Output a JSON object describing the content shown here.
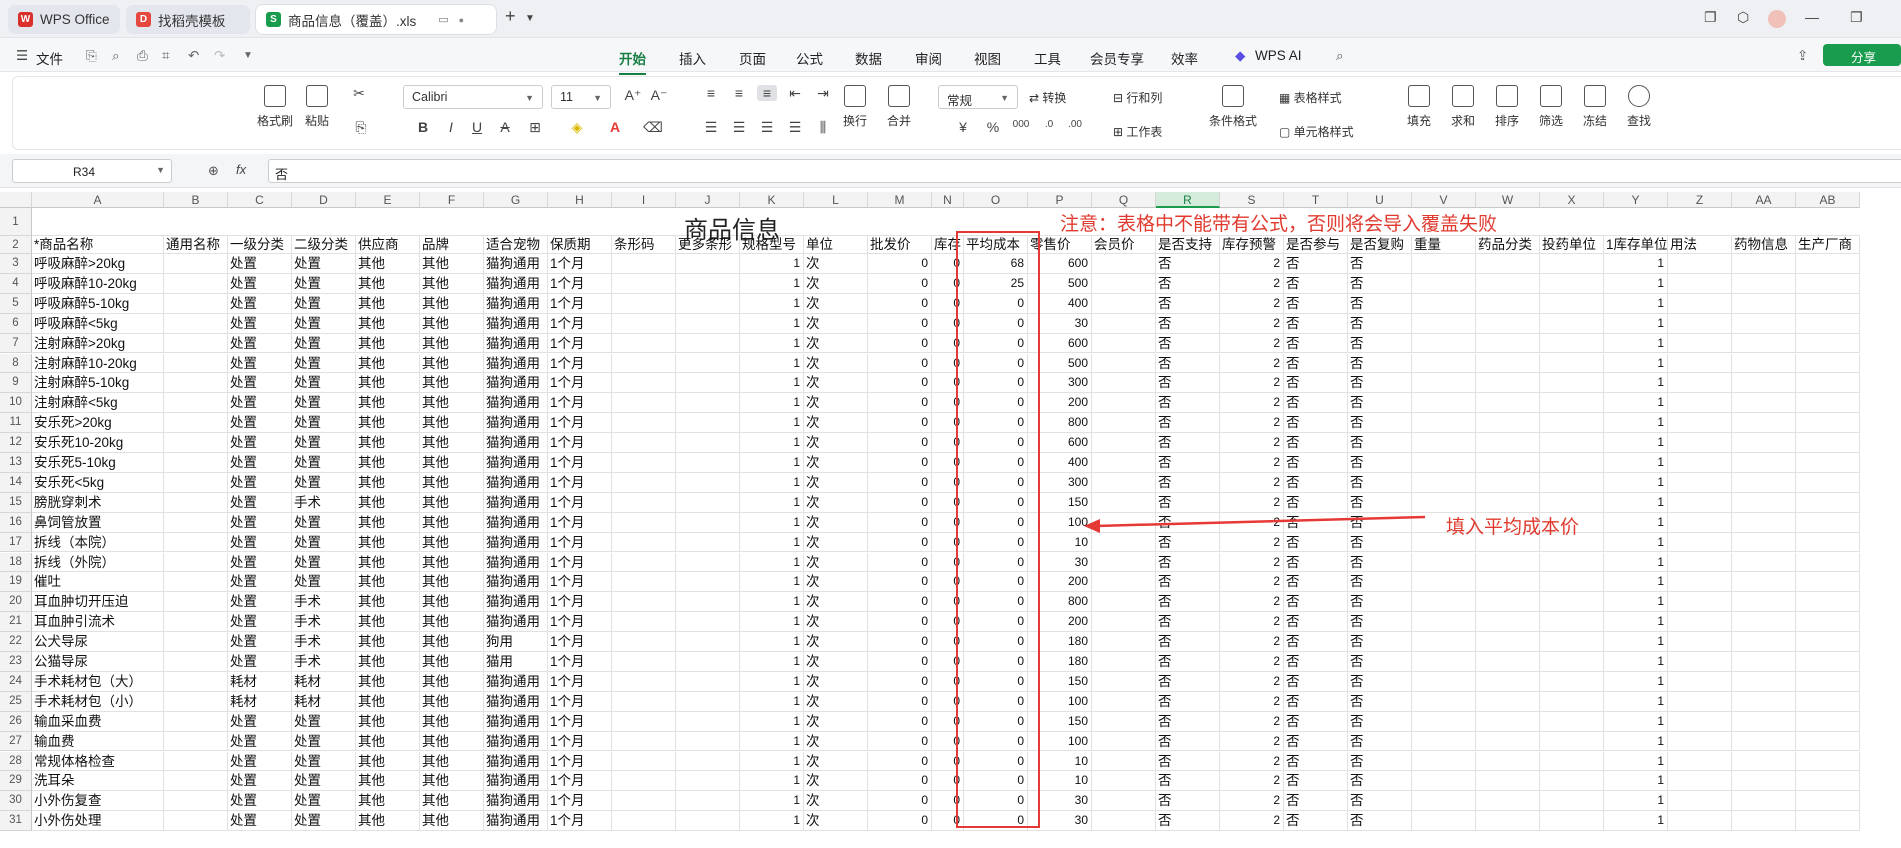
{
  "tabs": {
    "items": [
      {
        "label": "WPS Office",
        "icon": "wps-logo-icon"
      },
      {
        "label": "找稻壳模板",
        "icon": "docer-icon"
      },
      {
        "label": "商品信息（覆盖）.xls",
        "icon": "sheet-icon"
      }
    ],
    "new_tab": "+"
  },
  "menu": {
    "file": "文件",
    "tabs": [
      "开始",
      "插入",
      "页面",
      "公式",
      "数据",
      "审阅",
      "视图",
      "工具",
      "会员专享",
      "效率"
    ],
    "active_tab": "开始",
    "ai": "WPS AI",
    "share": "分享"
  },
  "ribbon": {
    "format_painter": "格式刷",
    "paste": "粘贴",
    "font_name": "Calibri",
    "font_size": "11",
    "wrap": "换行",
    "merge": "合并",
    "number_format": "常规",
    "convert": "转换",
    "row_col": "行和列",
    "worksheet": "工作表",
    "cond_format": "条件格式",
    "table_style": "表格样式",
    "cell_style": "单元格样式",
    "fill": "填充",
    "sum": "求和",
    "sort": "排序",
    "filter": "筛选",
    "freeze": "冻结",
    "find": "查找",
    "currency": "¥",
    "percent": "%"
  },
  "formula_bar": {
    "name_box": "R34",
    "fx": "fx",
    "content": "否"
  },
  "sheet": {
    "columns": [
      "A",
      "B",
      "C",
      "D",
      "E",
      "F",
      "G",
      "H",
      "I",
      "J",
      "K",
      "L",
      "M",
      "N",
      "O",
      "P",
      "Q",
      "R",
      "S",
      "T",
      "U",
      "V",
      "W",
      "X",
      "Y",
      "Z",
      "AA",
      "AB"
    ],
    "selected_column": "R",
    "title": "商品信息",
    "headers": [
      "*商品名称",
      "通用名称",
      "一级分类",
      "二级分类",
      "供应商",
      "品牌",
      "适合宠物",
      "保质期",
      "条形码",
      "更多条形",
      "规格型号",
      "单位",
      "批发价",
      "库存",
      "平均成本",
      "零售价",
      "会员价",
      "是否支持",
      "库存预警",
      "是否参与",
      "是否复购",
      "重量",
      "药品分类",
      "投药单位",
      "1库存单位",
      "用法",
      "药物信息",
      "生产厂商"
    ],
    "rows": [
      {
        "n": "3",
        "a": "呼吸麻醉>20kg",
        "c": "处置",
        "d": "处置",
        "e": "其他",
        "f": "其他",
        "g": "猫狗通用",
        "h": "1个月",
        "k": "1",
        "l": "次",
        "m": "0",
        "n2": "0",
        "o": "68",
        "p": "600",
        "r": "否",
        "s": "2",
        "t": "否",
        "u": "否",
        "y": "1"
      },
      {
        "n": "4",
        "a": "呼吸麻醉10-20kg",
        "c": "处置",
        "d": "处置",
        "e": "其他",
        "f": "其他",
        "g": "猫狗通用",
        "h": "1个月",
        "k": "1",
        "l": "次",
        "m": "0",
        "n2": "0",
        "o": "25",
        "p": "500",
        "r": "否",
        "s": "2",
        "t": "否",
        "u": "否",
        "y": "1"
      },
      {
        "n": "5",
        "a": "呼吸麻醉5-10kg",
        "c": "处置",
        "d": "处置",
        "e": "其他",
        "f": "其他",
        "g": "猫狗通用",
        "h": "1个月",
        "k": "1",
        "l": "次",
        "m": "0",
        "n2": "0",
        "o": "0",
        "p": "400",
        "r": "否",
        "s": "2",
        "t": "否",
        "u": "否",
        "y": "1"
      },
      {
        "n": "6",
        "a": "呼吸麻醉<5kg",
        "c": "处置",
        "d": "处置",
        "e": "其他",
        "f": "其他",
        "g": "猫狗通用",
        "h": "1个月",
        "k": "1",
        "l": "次",
        "m": "0",
        "n2": "0",
        "o": "0",
        "p": "30",
        "r": "否",
        "s": "2",
        "t": "否",
        "u": "否",
        "y": "1"
      },
      {
        "n": "7",
        "a": "注射麻醉>20kg",
        "c": "处置",
        "d": "处置",
        "e": "其他",
        "f": "其他",
        "g": "猫狗通用",
        "h": "1个月",
        "k": "1",
        "l": "次",
        "m": "0",
        "n2": "0",
        "o": "0",
        "p": "600",
        "r": "否",
        "s": "2",
        "t": "否",
        "u": "否",
        "y": "1"
      },
      {
        "n": "8",
        "a": "注射麻醉10-20kg",
        "c": "处置",
        "d": "处置",
        "e": "其他",
        "f": "其他",
        "g": "猫狗通用",
        "h": "1个月",
        "k": "1",
        "l": "次",
        "m": "0",
        "n2": "0",
        "o": "0",
        "p": "500",
        "r": "否",
        "s": "2",
        "t": "否",
        "u": "否",
        "y": "1"
      },
      {
        "n": "9",
        "a": "注射麻醉5-10kg",
        "c": "处置",
        "d": "处置",
        "e": "其他",
        "f": "其他",
        "g": "猫狗通用",
        "h": "1个月",
        "k": "1",
        "l": "次",
        "m": "0",
        "n2": "0",
        "o": "0",
        "p": "300",
        "r": "否",
        "s": "2",
        "t": "否",
        "u": "否",
        "y": "1"
      },
      {
        "n": "10",
        "a": "注射麻醉<5kg",
        "c": "处置",
        "d": "处置",
        "e": "其他",
        "f": "其他",
        "g": "猫狗通用",
        "h": "1个月",
        "k": "1",
        "l": "次",
        "m": "0",
        "n2": "0",
        "o": "0",
        "p": "200",
        "r": "否",
        "s": "2",
        "t": "否",
        "u": "否",
        "y": "1"
      },
      {
        "n": "11",
        "a": "安乐死>20kg",
        "c": "处置",
        "d": "处置",
        "e": "其他",
        "f": "其他",
        "g": "猫狗通用",
        "h": "1个月",
        "k": "1",
        "l": "次",
        "m": "0",
        "n2": "0",
        "o": "0",
        "p": "800",
        "r": "否",
        "s": "2",
        "t": "否",
        "u": "否",
        "y": "1"
      },
      {
        "n": "12",
        "a": "安乐死10-20kg",
        "c": "处置",
        "d": "处置",
        "e": "其他",
        "f": "其他",
        "g": "猫狗通用",
        "h": "1个月",
        "k": "1",
        "l": "次",
        "m": "0",
        "n2": "0",
        "o": "0",
        "p": "600",
        "r": "否",
        "s": "2",
        "t": "否",
        "u": "否",
        "y": "1"
      },
      {
        "n": "13",
        "a": "安乐死5-10kg",
        "c": "处置",
        "d": "处置",
        "e": "其他",
        "f": "其他",
        "g": "猫狗通用",
        "h": "1个月",
        "k": "1",
        "l": "次",
        "m": "0",
        "n2": "0",
        "o": "0",
        "p": "400",
        "r": "否",
        "s": "2",
        "t": "否",
        "u": "否",
        "y": "1"
      },
      {
        "n": "14",
        "a": "安乐死<5kg",
        "c": "处置",
        "d": "处置",
        "e": "其他",
        "f": "其他",
        "g": "猫狗通用",
        "h": "1个月",
        "k": "1",
        "l": "次",
        "m": "0",
        "n2": "0",
        "o": "0",
        "p": "300",
        "r": "否",
        "s": "2",
        "t": "否",
        "u": "否",
        "y": "1"
      },
      {
        "n": "15",
        "a": "膀胱穿刺术",
        "c": "处置",
        "d": "手术",
        "e": "其他",
        "f": "其他",
        "g": "猫狗通用",
        "h": "1个月",
        "k": "1",
        "l": "次",
        "m": "0",
        "n2": "0",
        "o": "0",
        "p": "150",
        "r": "否",
        "s": "2",
        "t": "否",
        "u": "否",
        "y": "1"
      },
      {
        "n": "16",
        "a": "鼻饲管放置",
        "c": "处置",
        "d": "处置",
        "e": "其他",
        "f": "其他",
        "g": "猫狗通用",
        "h": "1个月",
        "k": "1",
        "l": "次",
        "m": "0",
        "n2": "0",
        "o": "0",
        "p": "100",
        "r": "否",
        "s": "2",
        "t": "否",
        "u": "否",
        "y": "1"
      },
      {
        "n": "17",
        "a": "拆线（本院）",
        "c": "处置",
        "d": "处置",
        "e": "其他",
        "f": "其他",
        "g": "猫狗通用",
        "h": "1个月",
        "k": "1",
        "l": "次",
        "m": "0",
        "n2": "0",
        "o": "0",
        "p": "10",
        "r": "否",
        "s": "2",
        "t": "否",
        "u": "否",
        "y": "1"
      },
      {
        "n": "18",
        "a": "拆线（外院）",
        "c": "处置",
        "d": "处置",
        "e": "其他",
        "f": "其他",
        "g": "猫狗通用",
        "h": "1个月",
        "k": "1",
        "l": "次",
        "m": "0",
        "n2": "0",
        "o": "0",
        "p": "30",
        "r": "否",
        "s": "2",
        "t": "否",
        "u": "否",
        "y": "1"
      },
      {
        "n": "19",
        "a": "催吐",
        "c": "处置",
        "d": "处置",
        "e": "其他",
        "f": "其他",
        "g": "猫狗通用",
        "h": "1个月",
        "k": "1",
        "l": "次",
        "m": "0",
        "n2": "0",
        "o": "0",
        "p": "200",
        "r": "否",
        "s": "2",
        "t": "否",
        "u": "否",
        "y": "1"
      },
      {
        "n": "20",
        "a": "耳血肿切开压迫",
        "c": "处置",
        "d": "手术",
        "e": "其他",
        "f": "其他",
        "g": "猫狗通用",
        "h": "1个月",
        "k": "1",
        "l": "次",
        "m": "0",
        "n2": "0",
        "o": "0",
        "p": "800",
        "r": "否",
        "s": "2",
        "t": "否",
        "u": "否",
        "y": "1"
      },
      {
        "n": "21",
        "a": "耳血肿引流术",
        "c": "处置",
        "d": "手术",
        "e": "其他",
        "f": "其他",
        "g": "猫狗通用",
        "h": "1个月",
        "k": "1",
        "l": "次",
        "m": "0",
        "n2": "0",
        "o": "0",
        "p": "200",
        "r": "否",
        "s": "2",
        "t": "否",
        "u": "否",
        "y": "1"
      },
      {
        "n": "22",
        "a": "公犬导尿",
        "c": "处置",
        "d": "手术",
        "e": "其他",
        "f": "其他",
        "g": "狗用",
        "h": "1个月",
        "k": "1",
        "l": "次",
        "m": "0",
        "n2": "0",
        "o": "0",
        "p": "180",
        "r": "否",
        "s": "2",
        "t": "否",
        "u": "否",
        "y": "1"
      },
      {
        "n": "23",
        "a": "公猫导尿",
        "c": "处置",
        "d": "手术",
        "e": "其他",
        "f": "其他",
        "g": "猫用",
        "h": "1个月",
        "k": "1",
        "l": "次",
        "m": "0",
        "n2": "0",
        "o": "0",
        "p": "180",
        "r": "否",
        "s": "2",
        "t": "否",
        "u": "否",
        "y": "1"
      },
      {
        "n": "24",
        "a": "手术耗材包（大）",
        "c": "耗材",
        "d": "耗材",
        "e": "其他",
        "f": "其他",
        "g": "猫狗通用",
        "h": "1个月",
        "k": "1",
        "l": "次",
        "m": "0",
        "n2": "0",
        "o": "0",
        "p": "150",
        "r": "否",
        "s": "2",
        "t": "否",
        "u": "否",
        "y": "1"
      },
      {
        "n": "25",
        "a": "手术耗材包（小）",
        "c": "耗材",
        "d": "耗材",
        "e": "其他",
        "f": "其他",
        "g": "猫狗通用",
        "h": "1个月",
        "k": "1",
        "l": "次",
        "m": "0",
        "n2": "0",
        "o": "0",
        "p": "100",
        "r": "否",
        "s": "2",
        "t": "否",
        "u": "否",
        "y": "1"
      },
      {
        "n": "26",
        "a": "输血采血费",
        "c": "处置",
        "d": "处置",
        "e": "其他",
        "f": "其他",
        "g": "猫狗通用",
        "h": "1个月",
        "k": "1",
        "l": "次",
        "m": "0",
        "n2": "0",
        "o": "0",
        "p": "150",
        "r": "否",
        "s": "2",
        "t": "否",
        "u": "否",
        "y": "1"
      },
      {
        "n": "27",
        "a": "输血费",
        "c": "处置",
        "d": "处置",
        "e": "其他",
        "f": "其他",
        "g": "猫狗通用",
        "h": "1个月",
        "k": "1",
        "l": "次",
        "m": "0",
        "n2": "0",
        "o": "0",
        "p": "100",
        "r": "否",
        "s": "2",
        "t": "否",
        "u": "否",
        "y": "1"
      },
      {
        "n": "28",
        "a": "常规体格检查",
        "c": "处置",
        "d": "处置",
        "e": "其他",
        "f": "其他",
        "g": "猫狗通用",
        "h": "1个月",
        "k": "1",
        "l": "次",
        "m": "0",
        "n2": "0",
        "o": "0",
        "p": "10",
        "r": "否",
        "s": "2",
        "t": "否",
        "u": "否",
        "y": "1"
      },
      {
        "n": "29",
        "a": "洗耳朵",
        "c": "处置",
        "d": "处置",
        "e": "其他",
        "f": "其他",
        "g": "猫狗通用",
        "h": "1个月",
        "k": "1",
        "l": "次",
        "m": "0",
        "n2": "0",
        "o": "0",
        "p": "10",
        "r": "否",
        "s": "2",
        "t": "否",
        "u": "否",
        "y": "1"
      },
      {
        "n": "30",
        "a": "小外伤复查",
        "c": "处置",
        "d": "处置",
        "e": "其他",
        "f": "其他",
        "g": "猫狗通用",
        "h": "1个月",
        "k": "1",
        "l": "次",
        "m": "0",
        "n2": "0",
        "o": "0",
        "p": "30",
        "r": "否",
        "s": "2",
        "t": "否",
        "u": "否",
        "y": "1"
      },
      {
        "n": "31",
        "a": "小外伤处理",
        "c": "处置",
        "d": "处置",
        "e": "其他",
        "f": "其他",
        "g": "猫狗通用",
        "h": "1个月",
        "k": "1",
        "l": "次",
        "m": "0",
        "n2": "0",
        "o": "0",
        "p": "30",
        "r": "否",
        "s": "2",
        "t": "否",
        "u": "否",
        "y": "1"
      }
    ]
  },
  "annotations": {
    "note": "注意：表格中不能带有公式，否则将会导入覆盖失败",
    "arrow_label": "填入平均成本价",
    "color": "#e53935"
  },
  "colors": {
    "accent": "#1a7f45",
    "annotation": "#e53935"
  }
}
